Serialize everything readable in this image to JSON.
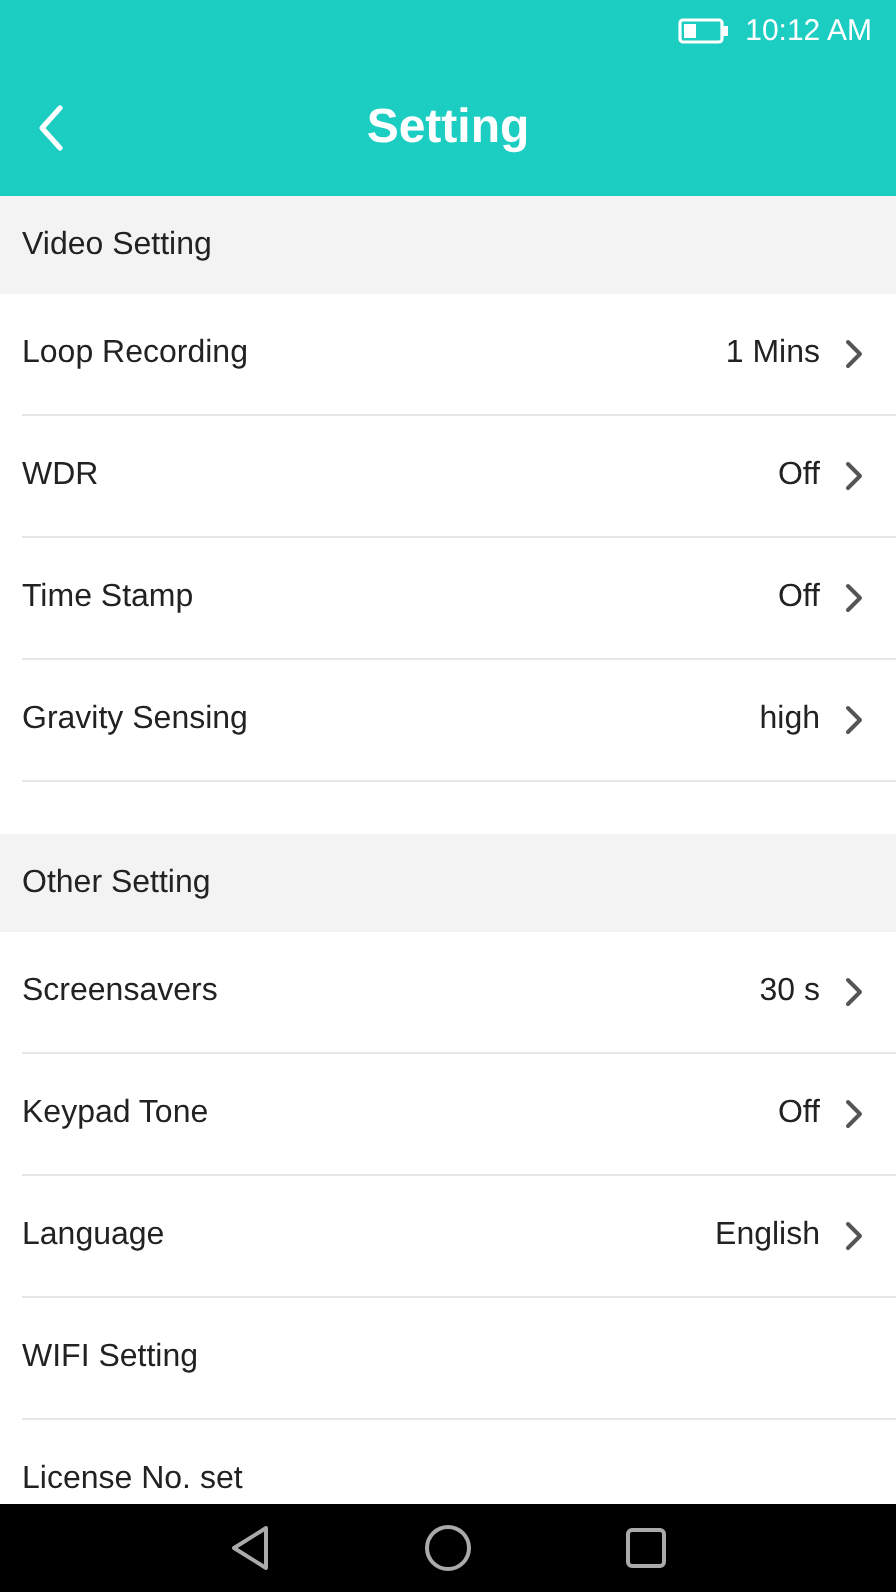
{
  "status_bar": {
    "time": "10:12 AM"
  },
  "header": {
    "title": "Setting"
  },
  "sections": [
    {
      "title": "Video Setting",
      "items": [
        {
          "label": "Loop Recording",
          "value": "1 Mins",
          "arrow": true
        },
        {
          "label": "WDR",
          "value": "Off",
          "arrow": true
        },
        {
          "label": "Time Stamp",
          "value": "Off",
          "arrow": true
        },
        {
          "label": "Gravity Sensing",
          "value": "high",
          "arrow": true
        }
      ]
    },
    {
      "title": "Other Setting",
      "items": [
        {
          "label": "Screensavers",
          "value": "30 s",
          "arrow": true
        },
        {
          "label": "Keypad Tone",
          "value": "Off",
          "arrow": true
        },
        {
          "label": "Language",
          "value": "English",
          "arrow": true
        },
        {
          "label": "WIFI Setting",
          "arrow": false
        },
        {
          "label": "License No. set",
          "arrow": false
        }
      ]
    }
  ]
}
